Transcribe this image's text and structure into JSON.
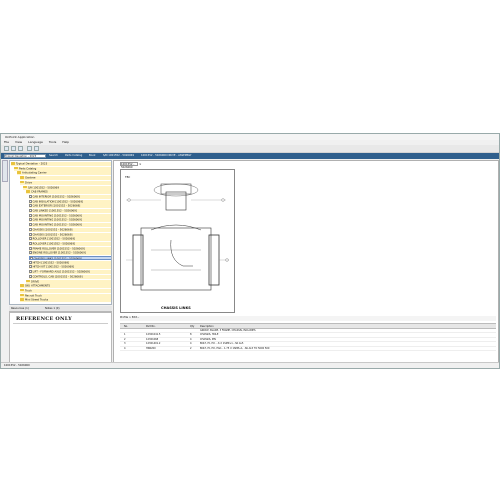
{
  "window": {
    "title": "OnPoint Application"
  },
  "menu": [
    "File",
    "View",
    "Language",
    "Tools",
    "Help"
  ],
  "tabs": {
    "active": "Typical Deviation - 2023",
    "rest": [
      "Search",
      "Parts Catalog",
      "Book",
      "S/N 1001552 - 5026069",
      "1001552 - 5026069 DRIVE - ASSEMBLY"
    ]
  },
  "tree": {
    "items": [
      {
        "label": "Typical Deviation - 2023",
        "icon": "folder",
        "indent": 0,
        "state": "hl"
      },
      {
        "label": "Parts Catalog",
        "icon": "folder",
        "indent": 1,
        "state": "hl"
      },
      {
        "label": "Articulating Carrier",
        "icon": "folder",
        "indent": 2,
        "state": "hl"
      },
      {
        "label": "Gantree",
        "icon": "folder",
        "indent": 3,
        "state": "hl"
      },
      {
        "label": "Drive",
        "icon": "folder",
        "indent": 3,
        "state": "hl"
      },
      {
        "label": "S/N 1001552 - 5026069",
        "icon": "folder",
        "indent": 4,
        "state": "hl"
      },
      {
        "label": "CAB FRAMES",
        "icon": "folder",
        "indent": 5,
        "state": "hl"
      },
      {
        "label": "CAB INTERIOR [1001552 - 5026069]",
        "icon": "doc",
        "indent": 6,
        "state": "hl"
      },
      {
        "label": "CAB INSULATION [1001552 - 5026069]",
        "icon": "doc",
        "indent": 6,
        "state": "hl"
      },
      {
        "label": "CAB EXTERIOR [1001552 - 5026069]",
        "icon": "doc",
        "indent": 6,
        "state": "hl"
      },
      {
        "label": "CAB LINKED [1001552 - 5026069]",
        "icon": "doc",
        "indent": 6,
        "state": "hl"
      },
      {
        "label": "CAB MOUNTING [1001552 - 5026069]",
        "icon": "doc",
        "indent": 6,
        "state": "hl"
      },
      {
        "label": "CAB MOUNTING [1001552 - 5026069]",
        "icon": "doc",
        "indent": 6,
        "state": "hl"
      },
      {
        "label": "CAB MOUNTING [1001552 - 5026069]",
        "icon": "doc",
        "indent": 6,
        "state": "hl"
      },
      {
        "label": "CHASSIS [1001552 - 5026069]",
        "icon": "doc",
        "indent": 6,
        "state": "hl"
      },
      {
        "label": "CHASSIS [1001552 - 5026069]",
        "icon": "doc",
        "indent": 6,
        "state": "hl"
      },
      {
        "label": "ROLLOVER [1001552 - 5026069]",
        "icon": "doc",
        "indent": 6,
        "state": "hl"
      },
      {
        "label": "ROLLOVER [1001552 - 5026069]",
        "icon": "doc",
        "indent": 6,
        "state": "hl"
      },
      {
        "label": "FRAME ROLLOVER [1001552 - 5026069]",
        "icon": "doc",
        "indent": 6,
        "state": "hl"
      },
      {
        "label": "ENGINE ROLLOVER [1001552 - 5026069]",
        "icon": "doc",
        "indent": 6,
        "state": "hl"
      },
      {
        "label": "CHASSIS LINKS [1001552 - 5026069]",
        "icon": "doc",
        "indent": 6,
        "state": "sel"
      },
      {
        "label": "HITCH [1001552 - 5026069]",
        "icon": "doc",
        "indent": 6,
        "state": "hl"
      },
      {
        "label": "HITCH KIT [1001552 - 5026069]",
        "icon": "doc",
        "indent": 6,
        "state": "hl"
      },
      {
        "label": "LIFT - FORWARD AXLE [1001552 - 5026069]",
        "icon": "doc",
        "indent": 6,
        "state": "hl"
      },
      {
        "label": "CONTROLS, CAB [1001552 - 5026069]",
        "icon": "doc",
        "indent": 6,
        "state": "hl"
      },
      {
        "label": "DRIVE",
        "icon": "folder",
        "indent": 5,
        "state": "hl"
      },
      {
        "label": "SKU ATTACHMENTS",
        "icon": "folder",
        "indent": 3,
        "state": "hl"
      },
      {
        "label": "Truck",
        "icon": "folder",
        "indent": 3,
        "state": "hl"
      },
      {
        "label": "Recruit Truck",
        "icon": "folder",
        "indent": 3,
        "state": "hl"
      },
      {
        "label": "Mini Street Trucks",
        "icon": "folder",
        "indent": 3,
        "state": "hl"
      }
    ]
  },
  "panel_tabs": [
    "Resources (1)",
    "Notes 1 (0)"
  ],
  "reference": {
    "title": "REFERENCE ONLY"
  },
  "document": {
    "tab_label": "1001552 - 5026069",
    "illustration_id": "TBC",
    "illustration_label": "CHASSIS LINKS",
    "parts_label": "Profile > Edit..."
  },
  "parts_table": {
    "headers": [
      "No.",
      "Part No.",
      "Qty",
      "Description"
    ],
    "rows": [
      [
        "",
        "",
        "",
        "GROUP, BLADE, 3 FRAME, CHASSIS, INCLUDES"
      ],
      [
        "1",
        "12301041.5",
        "8",
        "CHASSIS, HOLE"
      ],
      [
        "2",
        "12301068",
        "4",
        "CHASSIS, PIN"
      ],
      [
        "3",
        "12301401.2",
        "4",
        "BOLT, HI, HX - .6 X 1SMP+1, .SK AL5"
      ],
      [
        "4",
        "HN0200",
        "2",
        "BOLT, HI, HX, HG1 - 1.75 X 1SMP+1, .SK AL5 TO 5000 500"
      ]
    ]
  },
  "status": {
    "text": "1001552 - 5026069"
  }
}
